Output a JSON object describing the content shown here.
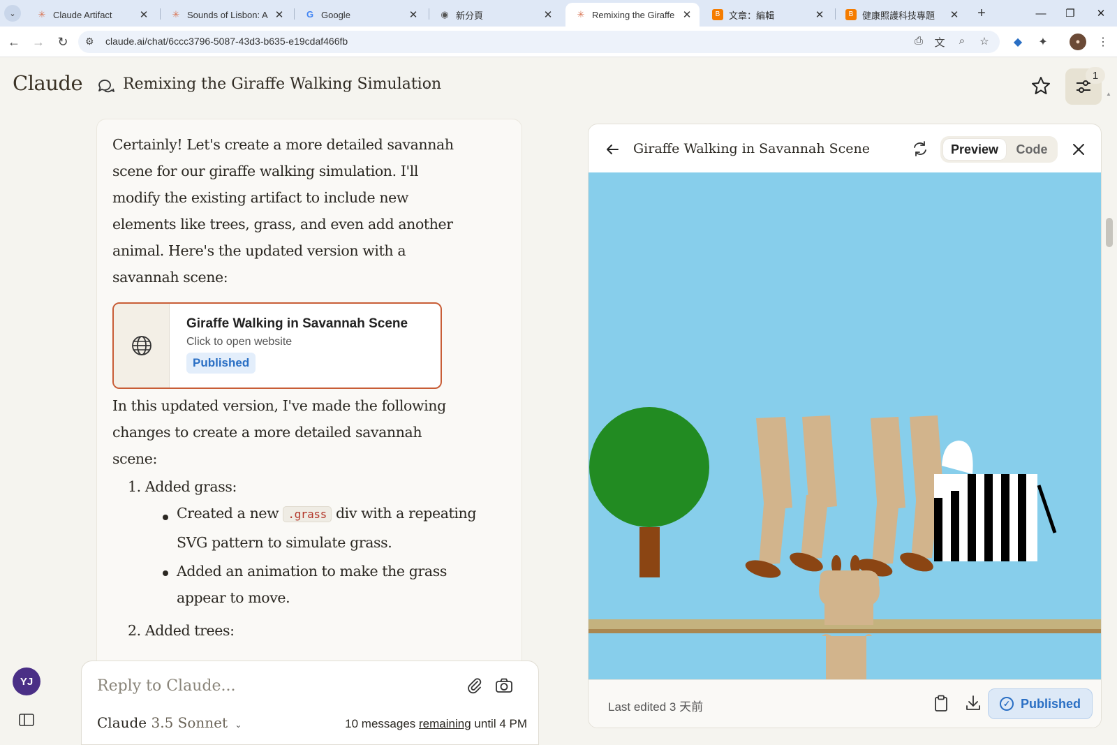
{
  "browser": {
    "tabs": [
      {
        "label": "Claude Artifact",
        "icon": "claude-icon",
        "active": false
      },
      {
        "label": "Sounds of Lisbon: A Vi",
        "icon": "claude-icon",
        "active": false
      },
      {
        "label": "Google",
        "icon": "google-icon",
        "active": false
      },
      {
        "label": "新分頁",
        "icon": "chrome-icon",
        "active": false
      },
      {
        "label": "Remixing the Giraffe W",
        "icon": "claude-icon",
        "active": true
      },
      {
        "label": "文章：編輯",
        "icon": "blogger-icon",
        "active": false
      },
      {
        "label": "健康照護科技專題",
        "icon": "blogger-icon",
        "active": false
      }
    ],
    "url": "claude.ai/chat/6ccc3796-5087-43d3-b635-e19cdaf466fb"
  },
  "header": {
    "logo": "Claude",
    "chat_title": "Remixing the Giraffe Walking Simulation",
    "notification_count": "1"
  },
  "message": {
    "intro": "Certainly! Let's create a more detailed savannah scene for our giraffe walking simulation. I'll modify the existing artifact to include new elements like trees, grass, and even add another animal. Here's the updated version with a savannah scene:",
    "artifact_card": {
      "title": "Giraffe Walking in Savannah Scene",
      "subtitle": "Click to open website",
      "badge": "Published"
    },
    "changes_intro": "In this updated version, I've made the following changes to create a more detailed savannah scene:",
    "list": [
      {
        "num": "1.",
        "title": "Added grass:",
        "bullets": [
          {
            "pre": "Created a new",
            "code": ".grass",
            "post": "div with a repeating SVG pattern to simulate grass."
          },
          {
            "pre": "Added an animation to make the grass appear to move.",
            "code": "",
            "post": ""
          }
        ]
      },
      {
        "num": "2.",
        "title": "Added trees:",
        "bullets": []
      }
    ]
  },
  "composer": {
    "placeholder": "Reply to Claude...",
    "model_name": "Claude",
    "model_version": "3.5 Sonnet",
    "remaining_pre": "10 messages",
    "remaining_link": "remaining",
    "remaining_post": "until 4 PM"
  },
  "user": {
    "initials": "YJ"
  },
  "panel": {
    "title": "Giraffe Walking in Savannah Scene",
    "preview_label": "Preview",
    "code_label": "Code",
    "last_edited": "Last edited 3 天前",
    "published_label": "Published"
  },
  "colors": {
    "accent_orange": "#c85d36",
    "sky": "#87ceeb",
    "tree_green": "#228b22",
    "trunk_brown": "#8b4513",
    "giraffe_tan": "#d2b48c",
    "published_blue": "#2a6fc4"
  }
}
